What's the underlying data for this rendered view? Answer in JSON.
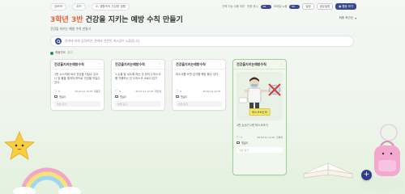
{
  "breadcrumb": [
    "담벼락",
    "피드",
    "6. 생활속의 건강한 생활"
  ],
  "controls": {
    "label_a": "선택 기능 사용 여부",
    "label_b": "모바일 노출",
    "label_c": "반응 표시",
    "label_d": "게시 노출",
    "toggle_text": "ON",
    "btn_settings": "설정",
    "btn_share": "공유설정",
    "btn_write": "활동 보기"
  },
  "header": {
    "grade": "3학년 3반",
    "title": "건강을 지키는 예방 수칙 만들기",
    "subtitle": "건강을 지키는 예방 수칙 만들기",
    "sort": "최종 최근순"
  },
  "search": {
    "placeholder": "관계에 대해 입력하면, 관계와 관련된 게시글이 노출됩니다."
  },
  "author": {
    "name": "최봉주도",
    "tag": "참고"
  },
  "cards": [
    {
      "title": "건강을지키는예방수칙",
      "body": "1번 소스처럼 써서 건강을 지킬수 있으니 앞 물을 챙겨야 하므로 건강을 지킬수 있다.",
      "likes": "0",
      "date": "25.02.11 12:07",
      "author": "최봉주",
      "comment_label": "댓글0",
      "comment_placeholder": "댓글 달기"
    },
    {
      "title": "건강을지키는예방수칙",
      "body": "1.손을 잘 씻도록 하는 것 방지 2.마스크를 착용하는 것 3.마스크 코로나 감기",
      "likes": "0",
      "date": "25.02.11 12:07",
      "author": "최진영",
      "comment_label": "댓글0",
      "comment_placeholder": "댓글 달기"
    },
    {
      "title": "건강을지키는예방수칙",
      "body": "마스크를 쓰면 감기를 예방 할수 있다.",
      "likes": "0",
      "date": "25.02.11 12:07",
      "author": "",
      "comment_label": "댓글0",
      "comment_placeholder": "댓글 달기"
    },
    {
      "title": "건강을지키는예방수칙",
      "illustration_label": "마스크쓰는어",
      "body": "1번 손씻기 2번 마스크쓰기",
      "likes": "0",
      "date": "25.02.11 12:07",
      "author": "강채희",
      "comment_label": "댓글0",
      "comment_placeholder": "댓글 달기"
    }
  ],
  "fab": {
    "label": "+"
  },
  "colors": {
    "accent": "#3a4a8a",
    "grade": "#e8623c",
    "selected_border": "#9fd09a"
  }
}
